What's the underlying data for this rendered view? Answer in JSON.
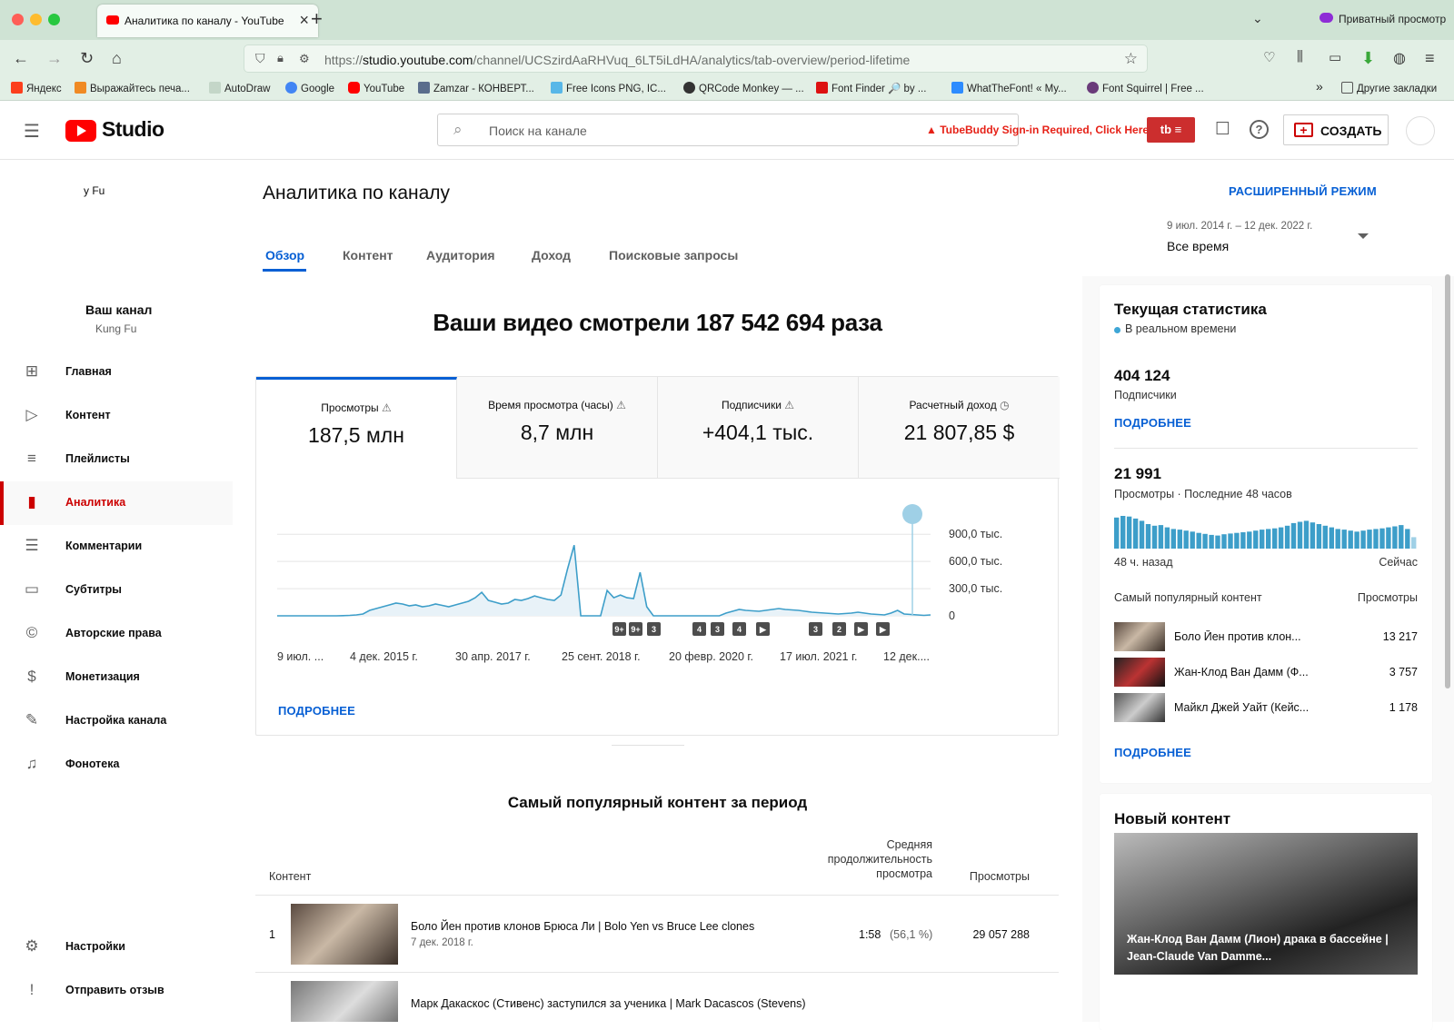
{
  "browser": {
    "tab_title": "Аналитика по каналу - YouTube",
    "private_label": "Приватный просмотр",
    "url_prefix": "https://",
    "url_host": "studio.youtube.com",
    "url_path": "/channel/UCSzirdAaRHVuq_6LT5iLdHA/analytics/tab-overview/period-lifetime",
    "bookmarks": [
      "Яндекс",
      "Выражайтесь печа...",
      "AutoDraw",
      "Google",
      "YouTube",
      "Zamzar - КОНВЕРТ...",
      "Free Icons PNG, IC...",
      "QRCode Monkey — ...",
      "Font Finder 🔎 by ...",
      "WhatTheFont! « My...",
      "Font Squirrel | Free ..."
    ],
    "other_bookmarks": "Другие закладки"
  },
  "studio": {
    "logo_text": "Studio",
    "search_placeholder": "Поиск на канале",
    "tubebuddy_warning": "TubeBuddy Sign-in Required, Click Here",
    "create_label": "СОЗДАТЬ"
  },
  "sidebar": {
    "channel_partial": "y Fu",
    "your_channel": "Ваш канал",
    "channel_name": "Kung Fu",
    "items": [
      {
        "label": "Главная",
        "icon": "dashboard-icon"
      },
      {
        "label": "Контент",
        "icon": "content-icon"
      },
      {
        "label": "Плейлисты",
        "icon": "playlists-icon"
      },
      {
        "label": "Аналитика",
        "icon": "analytics-icon",
        "active": true
      },
      {
        "label": "Комментарии",
        "icon": "comments-icon"
      },
      {
        "label": "Субтитры",
        "icon": "subtitles-icon"
      },
      {
        "label": "Авторские права",
        "icon": "copyright-icon"
      },
      {
        "label": "Монетизация",
        "icon": "monetization-icon"
      },
      {
        "label": "Настройка канала",
        "icon": "customization-icon"
      },
      {
        "label": "Фонотека",
        "icon": "audio-library-icon"
      }
    ],
    "bottom_items": [
      {
        "label": "Настройки",
        "icon": "settings-icon"
      },
      {
        "label": "Отправить отзыв",
        "icon": "feedback-icon"
      }
    ]
  },
  "analytics": {
    "page_title": "Аналитика по каналу",
    "advanced_mode": "РАСШИРЕННЫЙ РЕЖИМ",
    "date_range": "9 июл. 2014 г. – 12 дек. 2022 г.",
    "period": "Все время",
    "tabs": [
      "Обзор",
      "Контент",
      "Аудитория",
      "Доход",
      "Поисковые запросы"
    ],
    "headline": "Ваши видео смотрели 187 542 694 раза",
    "kpis": [
      {
        "label": "Просмотры",
        "value": "187,5 млн",
        "icon": "warning-icon"
      },
      {
        "label": "Время просмотра (часы)",
        "value": "8,7 млн",
        "icon": "warning-icon"
      },
      {
        "label": "Подписчики",
        "value": "+404,1 тыс.",
        "icon": "warning-icon"
      },
      {
        "label": "Расчетный доход",
        "value": "21 807,85 $",
        "icon": "clock-icon"
      }
    ],
    "more_label": "ПОДРОБНЕЕ",
    "top_content_title": "Самый популярный контент за период",
    "table_headers": {
      "content": "Контент",
      "avg_duration": "Средняя продолжительность просмотра",
      "views": "Просмотры"
    },
    "rows": [
      {
        "rank": "1",
        "title": "Боло Йен против клонов Брюса Ли | Bolo Yen vs Bruce Lee clones",
        "date": "7 дек. 2018 г.",
        "duration": "1:58",
        "percent": "(56,1 %)",
        "views": "29 057 288"
      },
      {
        "rank": "",
        "title": "Марк Дакаскос (Стивенс) заступился за ученика | Mark Dacascos (Stevens)",
        "date": "",
        "duration": "",
        "percent": "",
        "views": ""
      }
    ]
  },
  "chart_data": {
    "type": "area",
    "x_tick_labels": [
      "9 июл. ...",
      "4 дек. 2015 г.",
      "30 апр. 2017 г.",
      "25 сент. 2018 г.",
      "20 февр. 2020 г.",
      "17 июл. 2021 г.",
      "12 дек...."
    ],
    "y_tick_labels": [
      "900,0 тыс.",
      "600,0 тыс.",
      "300,0 тыс.",
      "0"
    ],
    "ylim": [
      0,
      1000000
    ],
    "series": [
      {
        "values": [
          0,
          0,
          0,
          0,
          0,
          0,
          0,
          0,
          0,
          0,
          2000,
          5000,
          10000,
          20000,
          60000,
          80000,
          100000,
          120000,
          140000,
          130000,
          110000,
          120000,
          100000,
          110000,
          130000,
          115000,
          100000,
          120000,
          140000,
          160000,
          200000,
          260000,
          170000,
          150000,
          130000,
          140000,
          180000,
          170000,
          190000,
          220000,
          200000,
          180000,
          170000,
          230000,
          520000,
          780000,
          0,
          0,
          0,
          0,
          280000,
          200000,
          230000,
          200000,
          190000,
          480000,
          100000,
          0,
          0,
          0,
          0,
          0,
          0,
          0,
          0,
          0,
          0,
          0,
          30000,
          50000,
          70000,
          60000,
          55000,
          50000,
          60000,
          70000,
          80000,
          70000,
          65000,
          60000,
          50000,
          40000,
          35000,
          30000,
          25000,
          20000,
          25000,
          30000,
          40000,
          30000,
          20000,
          15000,
          10000,
          30000,
          60000,
          20000,
          15000,
          10000,
          5000,
          10000
        ]
      }
    ],
    "grid": true,
    "annotation_badges": [
      "9+",
      "9+",
      "3",
      "4",
      "3",
      "4",
      "▶",
      "3",
      "2",
      "▶",
      "▶"
    ]
  },
  "realtime": {
    "title": "Текущая статистика",
    "subtitle": "В реальном времени",
    "subscribers_value": "404 124",
    "subscribers_label": "Подписчики",
    "more_label": "ПОДРОБНЕЕ",
    "views_value": "21 991",
    "views_label": "Просмотры · Последние 48 часов",
    "bars": [
      95,
      100,
      98,
      92,
      85,
      75,
      70,
      72,
      65,
      60,
      58,
      55,
      52,
      48,
      45,
      42,
      40,
      44,
      46,
      48,
      50,
      52,
      55,
      58,
      60,
      62,
      65,
      70,
      78,
      82,
      85,
      80,
      75,
      70,
      65,
      60,
      58,
      55,
      52,
      55,
      58,
      60,
      62,
      65,
      68,
      72,
      60,
      35
    ],
    "range_left": "48 ч. назад",
    "range_right": "Сейчас",
    "popular_header": "Самый популярный контент",
    "popular_views_header": "Просмотры",
    "popular": [
      {
        "title": "Боло Йен против клон...",
        "views": "13 217"
      },
      {
        "title": "Жан-Клод Ван Дамм (Ф...",
        "views": "3 757"
      },
      {
        "title": "Майкл Джей Уайт (Кейс...",
        "views": "1 178"
      }
    ],
    "new_content_title": "Новый контент",
    "new_content_caption": "Жан-Клод Ван Дамм (Лион) драка в бассейне | Jean-Claude Van Damme..."
  }
}
